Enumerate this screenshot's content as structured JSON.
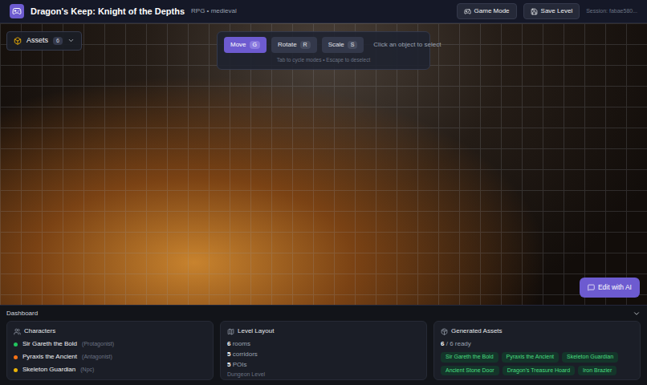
{
  "header": {
    "title": "Dragon's Keep: Knight of the Depths",
    "subtitle": "RPG • medieval",
    "buttons": [
      {
        "label": "Game Mode",
        "kind": "game"
      },
      {
        "label": "Save Level",
        "kind": "save"
      }
    ],
    "session": "Session: fabae580..."
  },
  "assets_button": {
    "label": "Assets",
    "count": "6"
  },
  "toolbar": {
    "modes": [
      {
        "label": "Move",
        "key": "G",
        "selected": true
      },
      {
        "label": "Rotate",
        "key": "R",
        "selected": false
      },
      {
        "label": "Scale",
        "key": "S",
        "selected": false
      }
    ],
    "hint": "Click an object to select",
    "help": "Tab to cycle modes • Escape to deselect"
  },
  "edit_ai": {
    "label": "Edit with AI"
  },
  "dashboard": {
    "title": "Dashboard",
    "characters": {
      "title": "Characters",
      "items": [
        {
          "name": "Sir Gareth the Bold",
          "role": "(Protagonist)",
          "color": "#22c55e"
        },
        {
          "name": "Pyraxis the Ancient",
          "role": "(Antagonist)",
          "color": "#f97316"
        },
        {
          "name": "Skeleton Guardian",
          "role": "(Npc)",
          "color": "#eab308"
        }
      ]
    },
    "layout": {
      "title": "Level Layout",
      "stats": [
        {
          "value": "6",
          "label": "rooms"
        },
        {
          "value": "5",
          "label": "corridors"
        },
        {
          "value": "5",
          "label": "POIs"
        }
      ],
      "caption": "Dungeon Level"
    },
    "assets": {
      "title": "Generated Assets",
      "ready": "6",
      "suffix": "/ 6 ready",
      "tags": [
        "Sir Gareth the Bold",
        "Pyraxis the Ancient",
        "Skeleton Guardian",
        "Ancient Stone Door",
        "Dragon's Treasure Hoard",
        "Iron Brazier"
      ]
    }
  }
}
